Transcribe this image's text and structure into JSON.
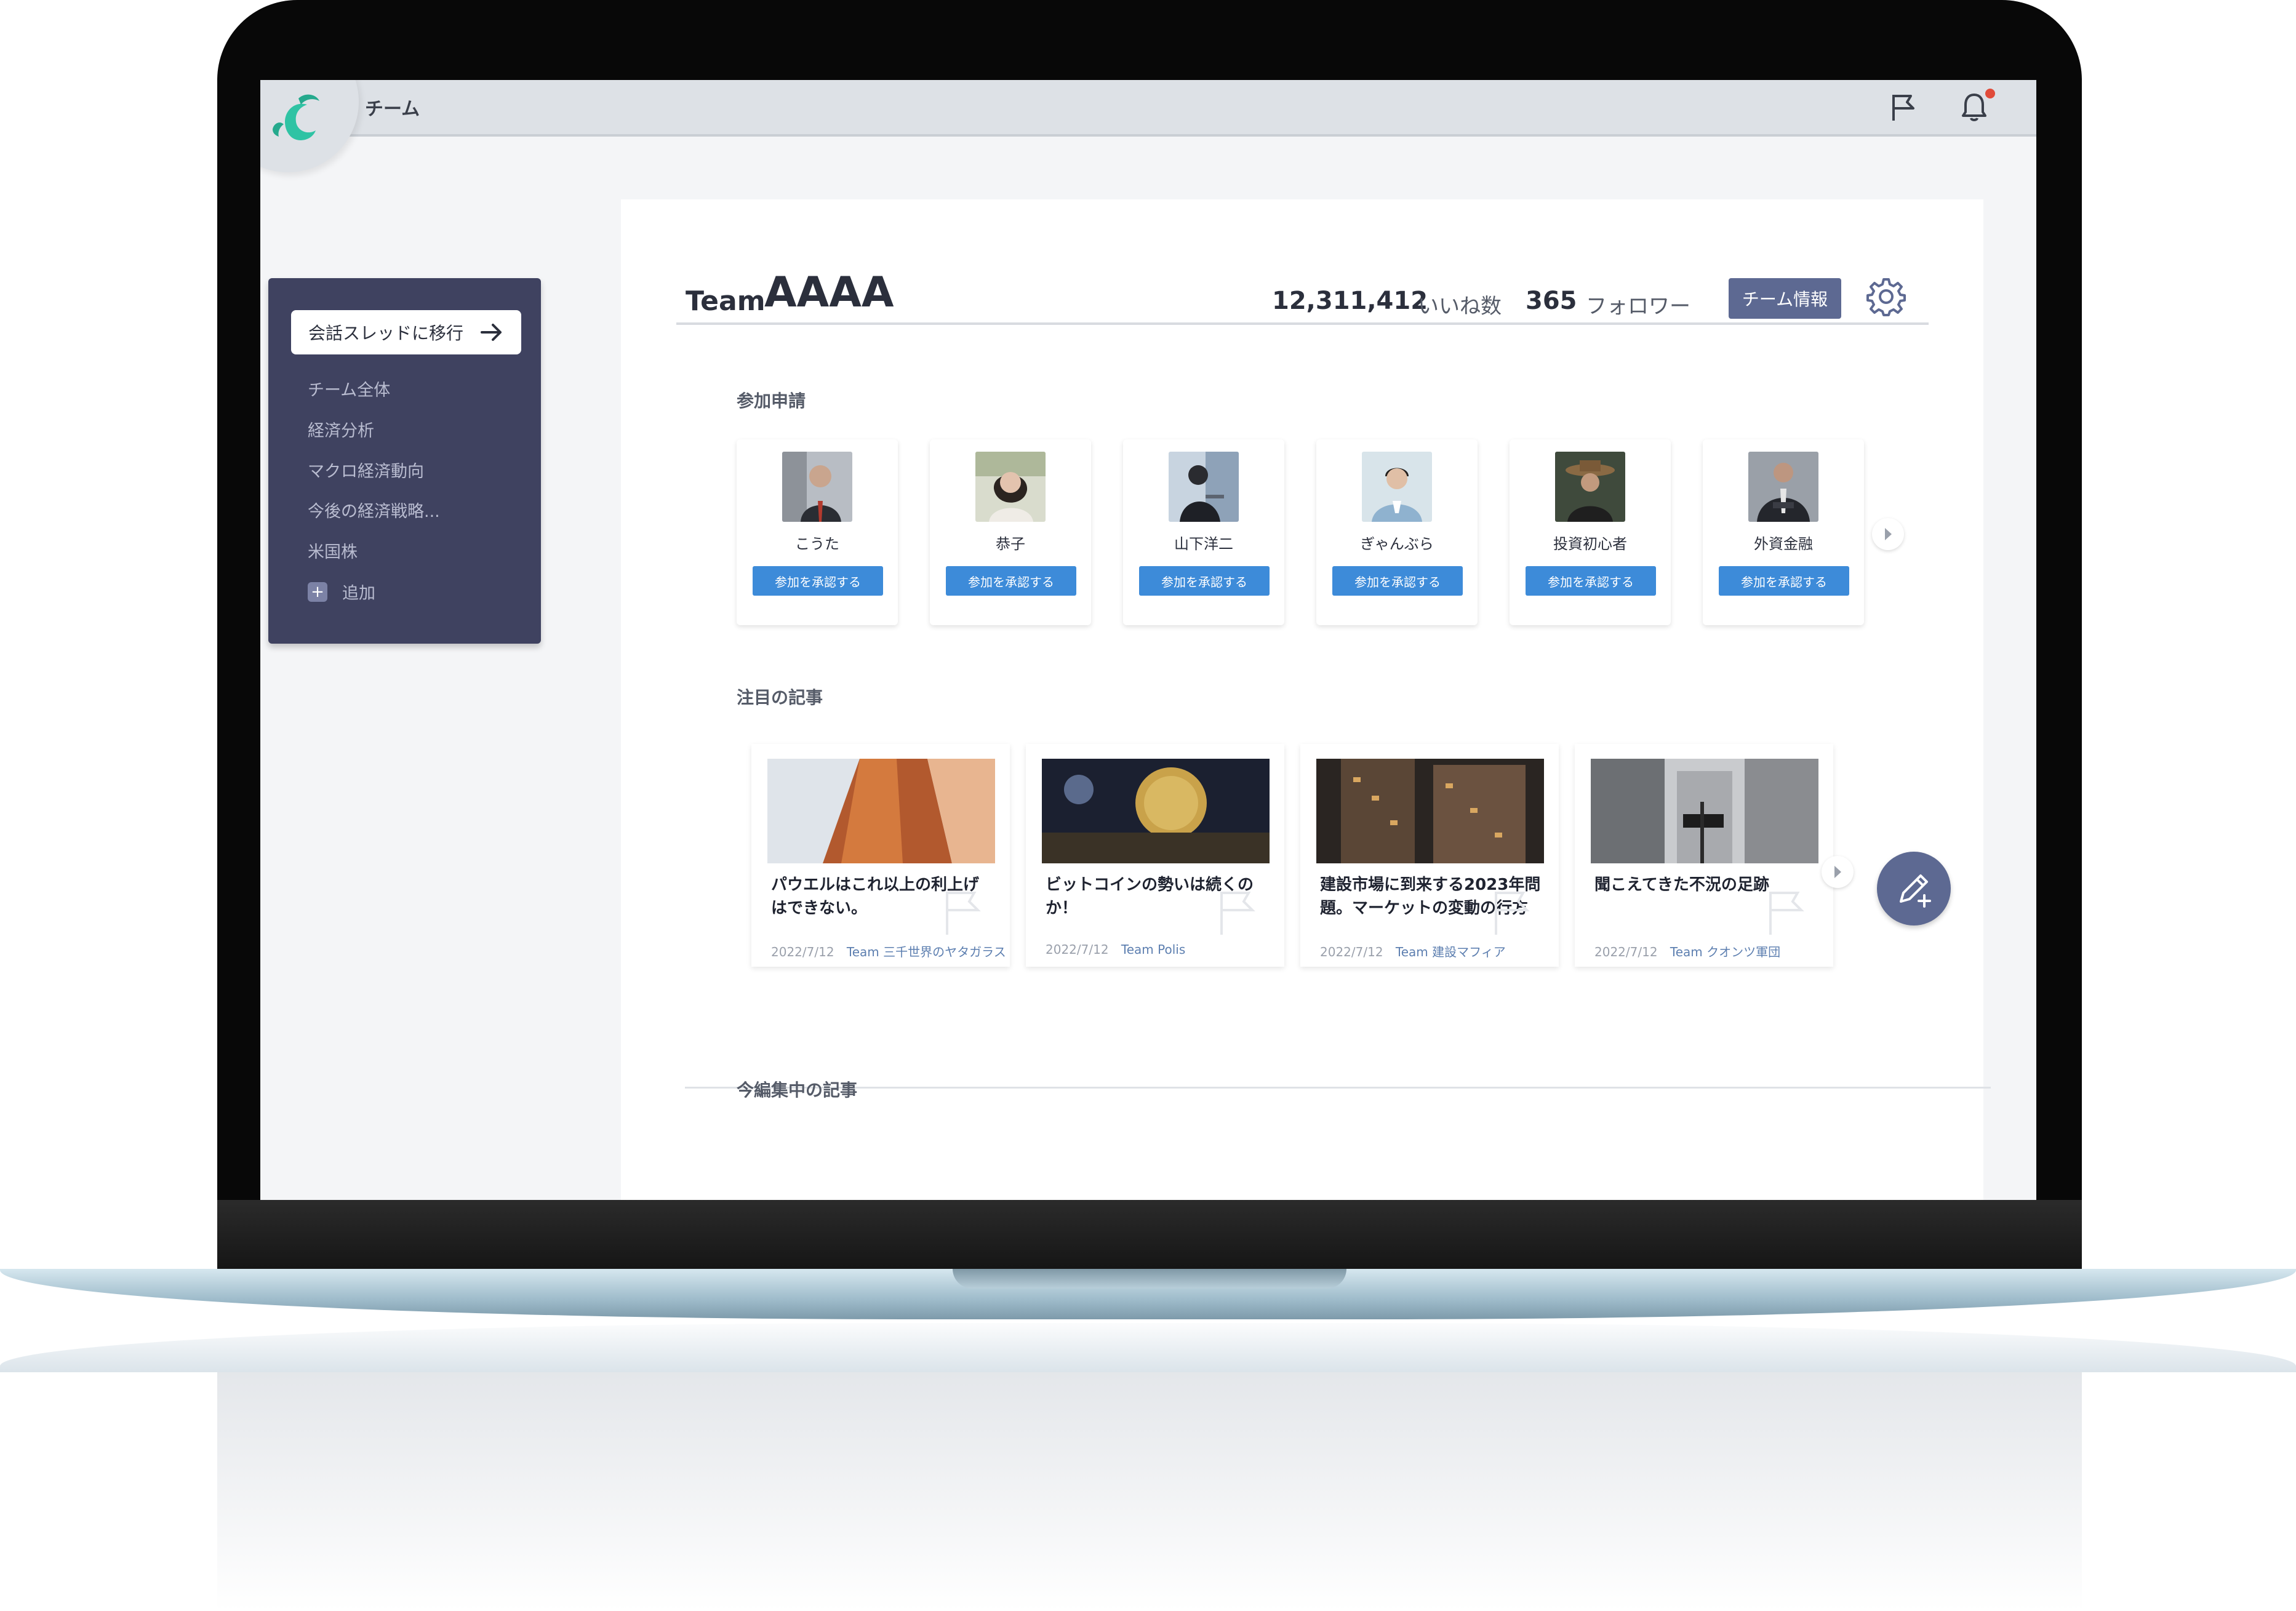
{
  "app": {
    "title": "チーム"
  },
  "sidebar": {
    "thread_button": "会話スレッドに移行",
    "items": [
      {
        "label": "チーム全体"
      },
      {
        "label": "経済分析"
      },
      {
        "label": "マクロ経済動向"
      },
      {
        "label": "今後の経済戦略..."
      },
      {
        "label": "米国株"
      }
    ],
    "add_label": "追加"
  },
  "header": {
    "team_prefix": "Team",
    "team_name": "AAAA",
    "likes_count": "12,311,412",
    "likes_label": "いいね数",
    "followers_count": "365",
    "followers_label": "フォロワー",
    "team_info_button": "チーム情報"
  },
  "join_requests": {
    "title": "参加申請",
    "members": [
      {
        "name": "こうた",
        "button": "参加を承認する"
      },
      {
        "name": "恭子",
        "button": "参加を承認する"
      },
      {
        "name": "山下洋二",
        "button": "参加を承認する"
      },
      {
        "name": "ぎゃんぶら",
        "button": "参加を承認する"
      },
      {
        "name": "投資初心者",
        "button": "参加を承認する"
      },
      {
        "name": "外資金融",
        "button": "参加を承認する"
      }
    ]
  },
  "featured": {
    "title": "注目の記事",
    "articles": [
      {
        "title": "パウエルはこれ以上の利上げはできない。",
        "date": "2022/7/12",
        "team": "Team 三千世界のヤタガラス"
      },
      {
        "title": "ビットコインの勢いは続くのか！",
        "date": "2022/7/12",
        "team": "Team Polis"
      },
      {
        "title": "建設市場に到来する2023年問題。マーケットの変動の行方",
        "date": "2022/7/12",
        "team": "Team 建設マフィア"
      },
      {
        "title": "聞こえてきた不況の足跡",
        "date": "2022/7/12",
        "team": "Team クオンツ軍団"
      }
    ]
  },
  "editing": {
    "title": "今編集中の記事"
  },
  "colors": {
    "sidebar_bg": "#3f4260",
    "accent": "#5d6992",
    "approve_button": "#3d8bd9",
    "notification_dot": "#e04b3a",
    "logo": "#2fc3a4"
  }
}
